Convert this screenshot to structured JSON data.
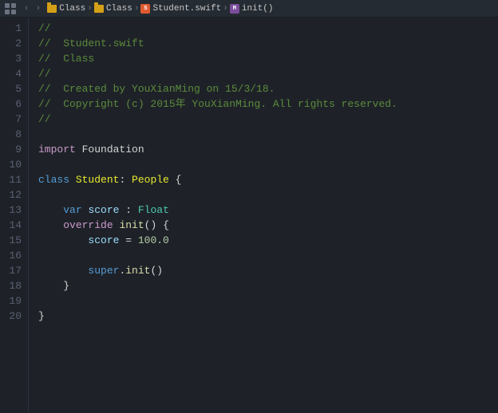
{
  "topbar": {
    "breadcrumb": [
      {
        "type": "folder",
        "label": "Class"
      },
      {
        "type": "folder",
        "label": "Class"
      },
      {
        "type": "swift",
        "label": "Student.swift"
      },
      {
        "type": "method",
        "label": "init()"
      }
    ]
  },
  "editor": {
    "lines": [
      {
        "num": 1,
        "tokens": [
          {
            "t": "comment",
            "v": "//"
          }
        ]
      },
      {
        "num": 2,
        "tokens": [
          {
            "t": "comment",
            "v": "//  Student.swift"
          }
        ]
      },
      {
        "num": 3,
        "tokens": [
          {
            "t": "comment",
            "v": "//  Class"
          }
        ]
      },
      {
        "num": 4,
        "tokens": [
          {
            "t": "comment",
            "v": "//"
          }
        ]
      },
      {
        "num": 5,
        "tokens": [
          {
            "t": "comment",
            "v": "//  Created by YouXianMing on 15/3/18."
          }
        ]
      },
      {
        "num": 6,
        "tokens": [
          {
            "t": "comment",
            "v": "//  Copyright (c) 2015年 YouXianMing. All rights reserved."
          }
        ]
      },
      {
        "num": 7,
        "tokens": [
          {
            "t": "comment",
            "v": "//"
          }
        ]
      },
      {
        "num": 8,
        "tokens": []
      },
      {
        "num": 9,
        "tokens": [
          {
            "t": "keyword",
            "v": "import"
          },
          {
            "t": "plain",
            "v": " Foundation"
          }
        ]
      },
      {
        "num": 10,
        "tokens": []
      },
      {
        "num": 11,
        "tokens": [
          {
            "t": "keyword-blue",
            "v": "class"
          },
          {
            "t": "plain",
            "v": " "
          },
          {
            "t": "class-name",
            "v": "Student"
          },
          {
            "t": "plain",
            "v": ": "
          },
          {
            "t": "class-name",
            "v": "People"
          },
          {
            "t": "plain",
            "v": " {"
          }
        ]
      },
      {
        "num": 12,
        "tokens": []
      },
      {
        "num": 13,
        "tokens": [
          {
            "t": "plain",
            "v": "    "
          },
          {
            "t": "keyword-blue",
            "v": "var"
          },
          {
            "t": "plain",
            "v": " "
          },
          {
            "t": "var-name",
            "v": "score"
          },
          {
            "t": "plain",
            "v": " : "
          },
          {
            "t": "type-name",
            "v": "Float"
          }
        ]
      },
      {
        "num": 14,
        "tokens": [
          {
            "t": "plain",
            "v": "    "
          },
          {
            "t": "keyword",
            "v": "override"
          },
          {
            "t": "plain",
            "v": " "
          },
          {
            "t": "func-call",
            "v": "init"
          },
          {
            "t": "plain",
            "v": "() {"
          }
        ]
      },
      {
        "num": 15,
        "tokens": [
          {
            "t": "plain",
            "v": "        "
          },
          {
            "t": "var-name",
            "v": "score"
          },
          {
            "t": "plain",
            "v": " = "
          },
          {
            "t": "number-val",
            "v": "100.0"
          }
        ]
      },
      {
        "num": 16,
        "tokens": []
      },
      {
        "num": 17,
        "tokens": [
          {
            "t": "plain",
            "v": "        "
          },
          {
            "t": "keyword-blue",
            "v": "super"
          },
          {
            "t": "plain",
            "v": "."
          },
          {
            "t": "func-call",
            "v": "init"
          },
          {
            "t": "plain",
            "v": "()"
          }
        ]
      },
      {
        "num": 18,
        "tokens": [
          {
            "t": "plain",
            "v": "    }"
          }
        ]
      },
      {
        "num": 19,
        "tokens": []
      },
      {
        "num": 20,
        "tokens": [
          {
            "t": "plain",
            "v": "}"
          }
        ]
      }
    ]
  }
}
